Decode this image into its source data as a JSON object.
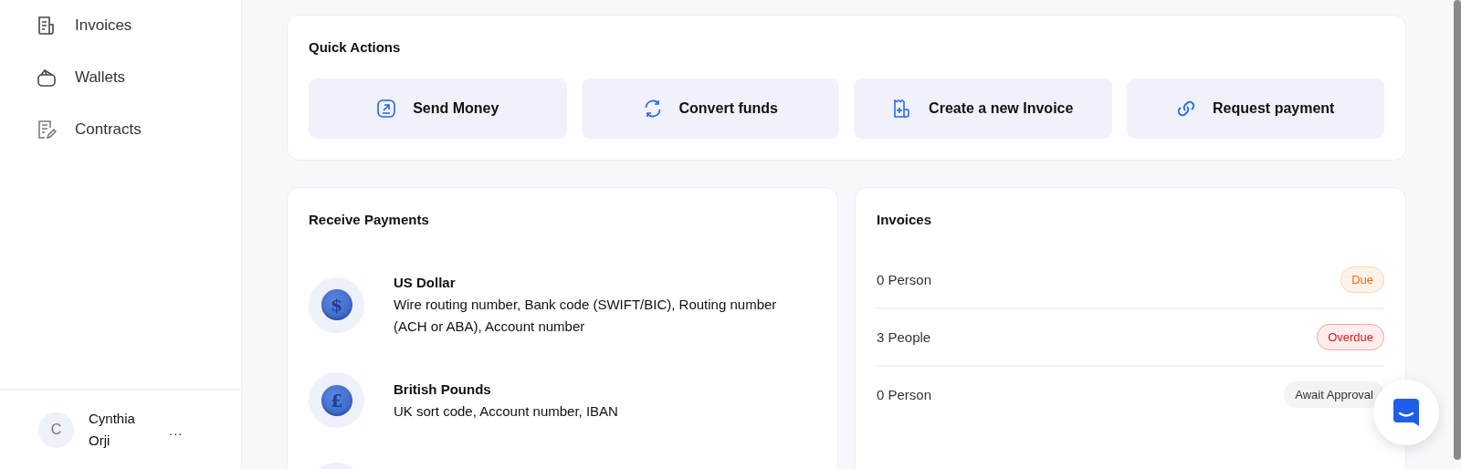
{
  "sidebar": {
    "items": [
      {
        "label": "Invoices",
        "kind": "invoice"
      },
      {
        "label": "Wallets",
        "kind": "wallet"
      },
      {
        "label": "Contracts",
        "kind": "contract"
      }
    ],
    "user": {
      "initial": "C",
      "name": "Cynthia Orji",
      "menu": "..."
    }
  },
  "quick_actions": {
    "title": "Quick Actions",
    "buttons": [
      {
        "label": "Send Money",
        "kind": "send"
      },
      {
        "label": "Convert funds",
        "kind": "convert"
      },
      {
        "label": "Create a new Invoice",
        "kind": "invoice"
      },
      {
        "label": "Request payment",
        "kind": "request"
      }
    ]
  },
  "receive_payments": {
    "title": "Receive Payments",
    "currencies": [
      {
        "name": "US Dollar",
        "symbol": "$",
        "details": "Wire routing number, Bank code (SWIFT/BIC), Routing number (ACH or ABA), Account number"
      },
      {
        "name": "British Pounds",
        "symbol": "£",
        "details": "UK sort code, Account number, IBAN"
      }
    ]
  },
  "invoices": {
    "title": "Invoices",
    "rows": [
      {
        "count": "0 Person",
        "status": "Due",
        "kind": "due"
      },
      {
        "count": "3 People",
        "status": "Overdue",
        "kind": "overdue"
      },
      {
        "count": "0 Person",
        "status": "Await Approval",
        "kind": "pending"
      }
    ]
  }
}
